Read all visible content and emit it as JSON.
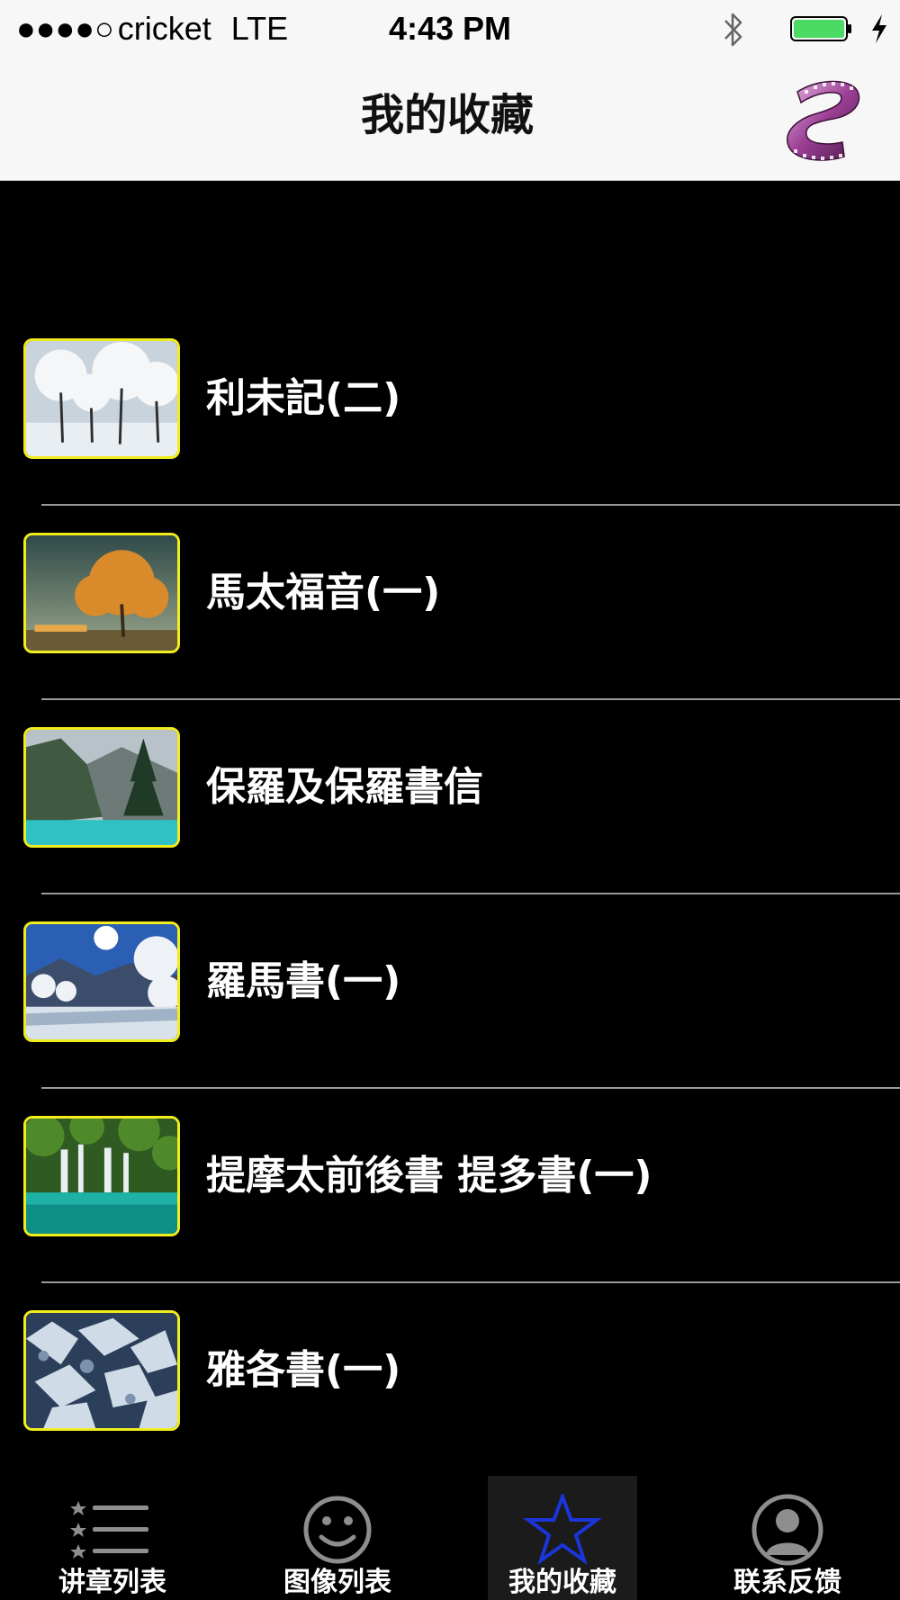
{
  "status_bar": {
    "signal": "●●●●○",
    "carrier": "cricket",
    "network": "LTE",
    "time": "4:43 PM"
  },
  "nav": {
    "title": "我的收藏",
    "right_icon": "film-reel-icon"
  },
  "favorites": [
    {
      "title": "利未記(二)",
      "thumbnail": "frosted-trees"
    },
    {
      "title": "馬太福音(一)",
      "thumbnail": "autumn-tree"
    },
    {
      "title": "保羅及保羅書信",
      "thumbnail": "mountain-lake"
    },
    {
      "title": "羅馬書(一)",
      "thumbnail": "snowy-sun-river"
    },
    {
      "title": "提摩太前後書 提多書(一)",
      "thumbnail": "waterfall-pool"
    },
    {
      "title": "雅各書(一)",
      "thumbnail": "icy-rocks"
    }
  ],
  "tabs": [
    {
      "label": "讲章列表",
      "icon": "star-list-icon",
      "selected": false
    },
    {
      "label": "图像列表",
      "icon": "smiley-icon",
      "selected": false
    },
    {
      "label": "我的收藏",
      "icon": "star-icon",
      "selected": true
    },
    {
      "label": "联系反馈",
      "icon": "contact-icon",
      "selected": false
    }
  ],
  "colors": {
    "background": "#000000",
    "bar_background": "#f7f7f7",
    "thumbnail_border": "#f1ec1c",
    "selected_tab_icon": "#1a35d9",
    "battery": "#4cd964"
  }
}
